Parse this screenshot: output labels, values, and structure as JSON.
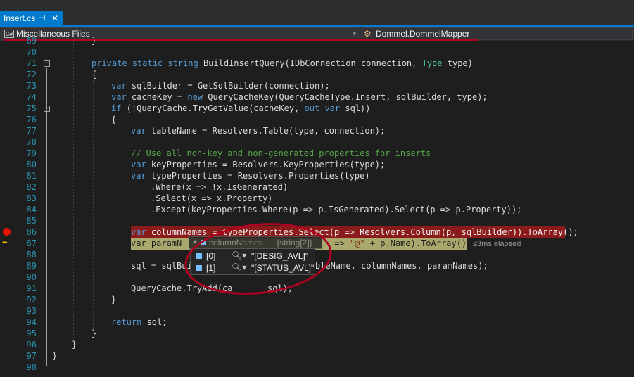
{
  "tab": {
    "title": "Insert.cs",
    "pin": "⊣",
    "close": "✕"
  },
  "nav": {
    "project": "Miscellaneous Files",
    "project_icon": "C#",
    "class_name": "Dommel.DommelMapper",
    "dropdown": "▾"
  },
  "lines": [
    "69",
    "70",
    "71",
    "72",
    "73",
    "74",
    "75",
    "76",
    "77",
    "78",
    "79",
    "80",
    "81",
    "82",
    "83",
    "84",
    "85",
    "86",
    "87",
    "88",
    "89",
    "90",
    "91",
    "92",
    "93",
    "94",
    "95",
    "96",
    "97",
    "98"
  ],
  "code": {
    "l69": "}",
    "l71_kw": "private static string",
    "l71_name": " BuildInsertQuery(IDbConnection connection, ",
    "l71_type": "Type",
    "l71_end": " type)",
    "l72": "{",
    "l73_kw": "var",
    "l73_rest": " sqlBuilder = GetSqlBuilder(connection);",
    "l74_kw": "var",
    "l74_mid": " cacheKey = ",
    "l74_new": "new",
    "l74_rest": " QueryCacheKey(QueryCacheType.Insert, sqlBuilder, type);",
    "l75_kw": "if",
    "l75_mid": " (!QueryCache.TryGetValue(cacheKey, ",
    "l75_out": "out var",
    "l75_rest": " sql))",
    "l76": "{",
    "l77_kw": "var",
    "l77_rest": " tableName = Resolvers.Table(type, connection);",
    "l79": "// Use all non-key and non-generated properties for inserts",
    "l80_kw": "var",
    "l80_rest": " keyProperties = Resolvers.KeyProperties(type);",
    "l81_kw": "var",
    "l81_rest": " typeProperties = Resolvers.Properties(type)",
    "l82": ".Where(x => !x.IsGenerated)",
    "l83": ".Select(x => x.Property)",
    "l84": ".Except(keyProperties.Where(p => p.IsGenerated).Select(p => p.Property));",
    "l86_kw": "var",
    "l86_rest": " columnNames = typeProperties.Select(p => Resolvers.Column(p, sqlBuilder)).ToArray();",
    "l87_kw": "var",
    "l87_a": " paramN",
    "l87_b": " => ",
    "l87_str": "\"@\"",
    "l87_c": " + p.Name).ToArray();",
    "l89_a": "sql = sqlBui",
    "l89_b": "bleName, columnNames, paramNames);",
    "l91_a": "QueryCache.TryAdd(ca",
    "l91_b": "sql);",
    "l92": "}",
    "l94_kw": "return",
    "l94_rest": " sql;",
    "l95": "}",
    "l96": "}",
    "l97": "}"
  },
  "elapsed": "≤3ms elapsed",
  "datatip": {
    "name": "columnNames",
    "type": "{string[2]}",
    "items": [
      {
        "index": "[0]",
        "value": "\"[DESIG_AVL]\""
      },
      {
        "index": "[1]",
        "value": "\"[STATUS_AVL]\""
      }
    ]
  },
  "colors": {
    "accent": "#007acc",
    "breakpoint": "#e51400",
    "annotation": "#b00020"
  }
}
